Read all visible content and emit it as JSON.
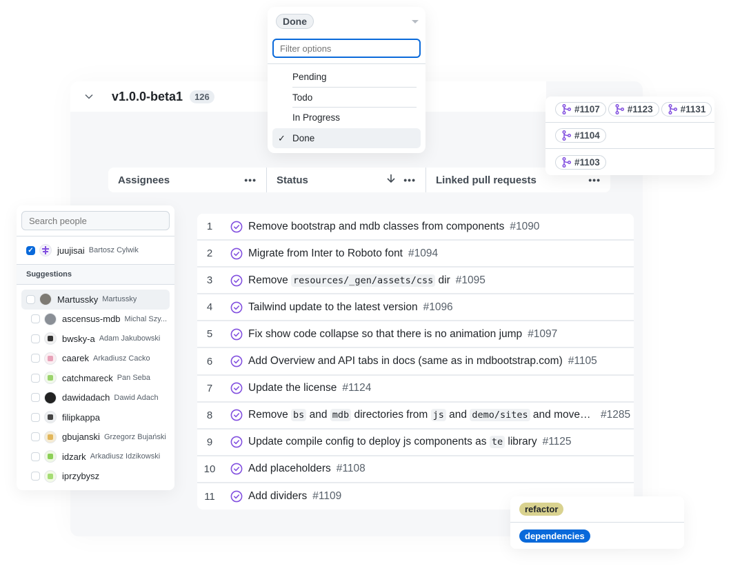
{
  "group": {
    "title": "v1.0.0-beta1",
    "count": "126"
  },
  "columns": [
    {
      "label": "Assignees",
      "menu": "•••"
    },
    {
      "label": "Status",
      "sort": "↓",
      "menu": "•••"
    },
    {
      "label": "Linked pull requests",
      "menu": "•••"
    }
  ],
  "status_dropdown": {
    "current": "Done",
    "filter_placeholder": "Filter options",
    "options": [
      {
        "label": "Pending",
        "selected": false
      },
      {
        "label": "Todo",
        "selected": false
      },
      {
        "label": "In Progress",
        "selected": false
      },
      {
        "label": "Done",
        "selected": true
      }
    ],
    "check": "✓"
  },
  "linked_prs": [
    [
      "#1107",
      "#1123",
      "#1131"
    ],
    [
      "#1104"
    ],
    [
      "#1103"
    ]
  ],
  "people_picker": {
    "search_placeholder": "Search people",
    "assigned": {
      "login": "juujisai",
      "name": "Bartosz Cylwik",
      "checked": true
    },
    "suggestions_heading": "Suggestions",
    "suggestions": [
      {
        "login": "Martussky",
        "name": "Martussky"
      },
      {
        "login": "ascensus-mdb",
        "name": "Michal Szy..."
      },
      {
        "login": "bwsky-a",
        "name": "Adam Jakubowski"
      },
      {
        "login": "caarek",
        "name": "Arkadiusz Cacko"
      },
      {
        "login": "catchmareck",
        "name": "Pan Seba"
      },
      {
        "login": "dawidadach",
        "name": "Dawid Adach"
      },
      {
        "login": "filipkappa",
        "name": ""
      },
      {
        "login": "gbujanski",
        "name": "Grzegorz Bujański"
      },
      {
        "login": "idzark",
        "name": "Arkadiusz Idzikowski"
      },
      {
        "login": "iprzybysz",
        "name": ""
      }
    ]
  },
  "issues": [
    {
      "n": "1",
      "parts": [
        {
          "t": "Remove bootstrap and mdb classes from components"
        }
      ],
      "num": "#1090"
    },
    {
      "n": "2",
      "parts": [
        {
          "t": "Migrate from Inter to Roboto font"
        }
      ],
      "num": "#1094"
    },
    {
      "n": "3",
      "parts": [
        {
          "t": "Remove "
        },
        {
          "code": "resources/_gen/assets/css"
        },
        {
          "t": " dir"
        }
      ],
      "num": "#1095"
    },
    {
      "n": "4",
      "parts": [
        {
          "t": "Tailwind update to the latest version"
        }
      ],
      "num": "#1096"
    },
    {
      "n": "5",
      "parts": [
        {
          "t": "Fix show code collapse so that there is no animation jump"
        }
      ],
      "num": "#1097"
    },
    {
      "n": "6",
      "parts": [
        {
          "t": "Add Overview and API tabs in docs (same as in mdbootstrap.com)"
        }
      ],
      "num": "#1105"
    },
    {
      "n": "7",
      "parts": [
        {
          "t": "Update the license"
        }
      ],
      "num": "#1124"
    },
    {
      "n": "8",
      "parts": [
        {
          "t": "Remove "
        },
        {
          "code": "bs"
        },
        {
          "t": " and "
        },
        {
          "code": "mdb"
        },
        {
          "t": " directories from "
        },
        {
          "code": "js"
        },
        {
          "t": " and "
        },
        {
          "code": "demo/sites"
        },
        {
          "t": " and move co..."
        }
      ],
      "num": "#1285",
      "truncated": true
    },
    {
      "n": "9",
      "parts": [
        {
          "t": "Update compile config to deploy js components as "
        },
        {
          "code": "te"
        },
        {
          "t": " library"
        }
      ],
      "num": "#1125"
    },
    {
      "n": "10",
      "parts": [
        {
          "t": "Add placeholders"
        }
      ],
      "num": "#1108"
    },
    {
      "n": "11",
      "parts": [
        {
          "t": "Add dividers"
        }
      ],
      "num": "#1109"
    }
  ],
  "labels": [
    {
      "name": "refactor",
      "bg": "#d9d28f",
      "fg": "#1f2328"
    },
    {
      "name": "dependencies",
      "bg": "#0969da",
      "fg": "#ffffff"
    }
  ],
  "colors": {
    "done_purple": "#8250df",
    "accent_blue": "#0969da"
  }
}
